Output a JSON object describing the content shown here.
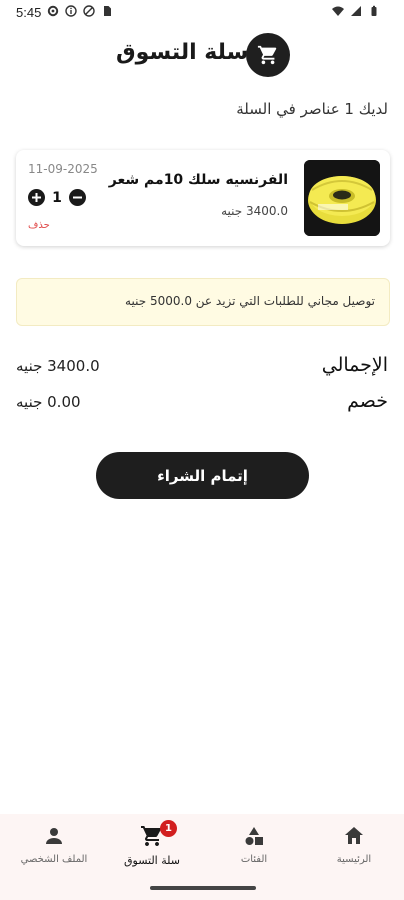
{
  "status_bar": {
    "time": "5:45",
    "icons_left": [
      "settings-gear-icon",
      "info-circle-icon",
      "do-not-disturb-icon",
      "sim-card-icon"
    ],
    "icons_right": [
      "wifi-icon",
      "signal-icon",
      "battery-icon"
    ]
  },
  "header": {
    "title": "سلة التسوق",
    "cart_icon": "shopping-cart-icon"
  },
  "cart_summary": {
    "items_count_text": "لديك 1 عناصر في السلة"
  },
  "cart_items": [
    {
      "name": "الفرنسيه سلك 10مم شعر",
      "price": "3400.0 جنيه",
      "date": "11-09-2025",
      "quantity": "1",
      "delete_label": "حذف"
    }
  ],
  "shipping_notice": {
    "text": "توصيل مجاني للطلبات التي تزيد عن 5000.0 جنيه"
  },
  "totals": {
    "total_label": "الإجمالي",
    "total_value": "3400.0 جنيه",
    "discount_label": "خصم",
    "discount_value": "0.00 جنيه"
  },
  "checkout": {
    "label": "إتمام الشراء"
  },
  "bottom_nav": {
    "items": [
      {
        "label": "الرئيسية",
        "icon": "home-icon",
        "active": false
      },
      {
        "label": "الفئات",
        "icon": "categories-icon",
        "active": false
      },
      {
        "label": "سلة التسوق",
        "icon": "cart-icon",
        "active": true,
        "badge": "1"
      },
      {
        "label": "الملف الشخصي",
        "icon": "profile-icon",
        "active": false
      }
    ]
  },
  "colors": {
    "primary": "#1e1e1e",
    "badge": "#d21f1f",
    "delete": "#e04848",
    "notice_bg": "#fffbe3",
    "nav_bg": "#fdf5f4"
  }
}
